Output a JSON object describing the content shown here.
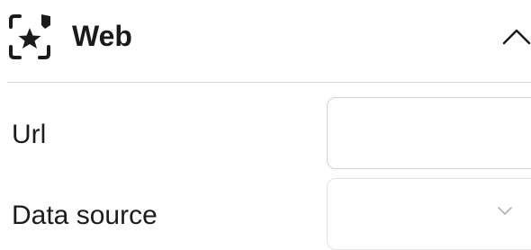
{
  "section": {
    "title": "Web",
    "icon": "sparkle-frame-icon",
    "collapse_icon": "chevron-up-icon"
  },
  "fields": {
    "url": {
      "label": "Url",
      "value": "",
      "placeholder": ""
    },
    "data_source": {
      "label": "Data source",
      "selected": "",
      "icon": "chevron-down-icon"
    }
  },
  "colors": {
    "text": "#1c1c1c",
    "border": "#d3d3d3",
    "divider": "#d6d6d6",
    "chevron_muted": "#b5b5b5"
  }
}
